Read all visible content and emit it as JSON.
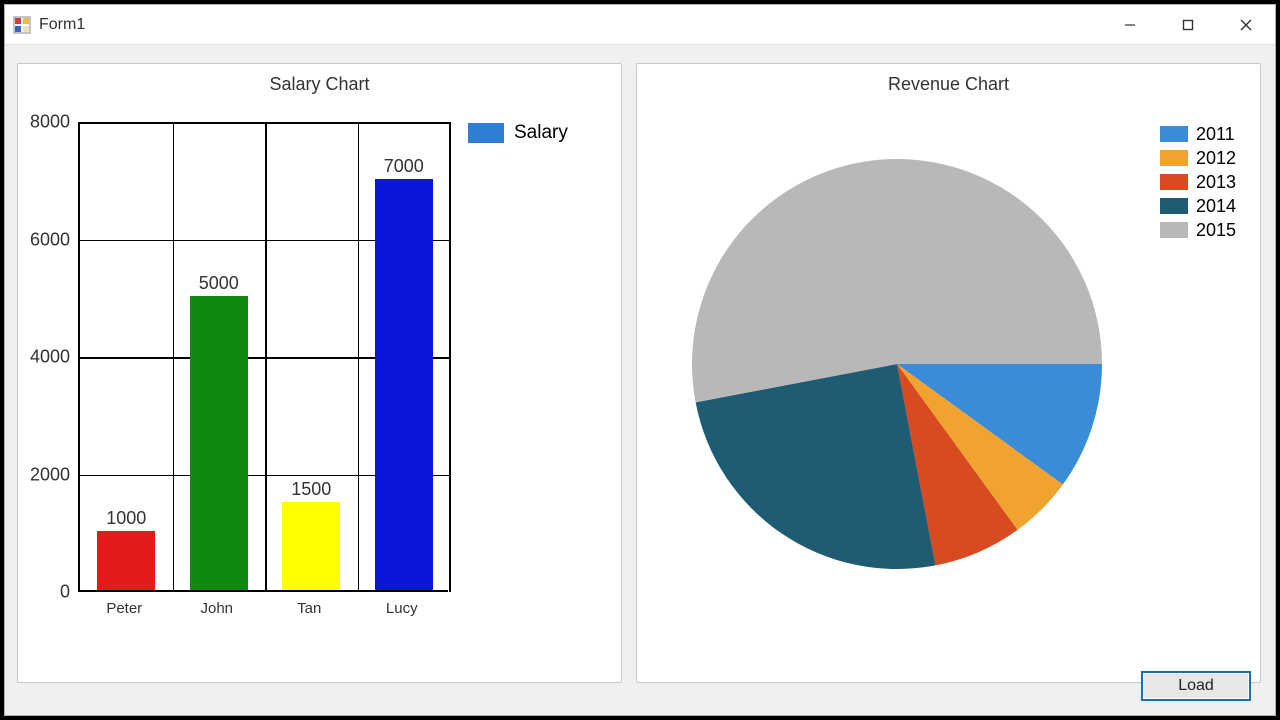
{
  "window": {
    "title": "Form1"
  },
  "buttons": {
    "load": "Load"
  },
  "legend": {
    "bar_series": "Salary"
  },
  "chart_data": [
    {
      "type": "bar",
      "title": "Salary Chart",
      "categories": [
        "Peter",
        "John",
        "Tan",
        "Lucy"
      ],
      "series": [
        {
          "name": "Salary",
          "values": [
            1000,
            5000,
            1500,
            7000
          ],
          "colors": [
            "#e21b1b",
            "#0f8a0f",
            "#ffff00",
            "#0a17d8"
          ]
        }
      ],
      "value_labels": [
        1000,
        5000,
        1500,
        7000
      ],
      "ylim": [
        0,
        8000
      ],
      "yticks": [
        0,
        2000,
        4000,
        6000,
        8000
      ],
      "legend_swatch_color": "#2f7ed8"
    },
    {
      "type": "pie",
      "title": "Revenue Chart",
      "categories": [
        "2011",
        "2012",
        "2013",
        "2014",
        "2015"
      ],
      "values": [
        10,
        5,
        7,
        25,
        53
      ],
      "colors": [
        "#3a8bd8",
        "#f0a32f",
        "#d84a1f",
        "#1f5b73",
        "#b8b8b8"
      ],
      "start_angle_deg": 0,
      "direction": "clockwise"
    }
  ]
}
